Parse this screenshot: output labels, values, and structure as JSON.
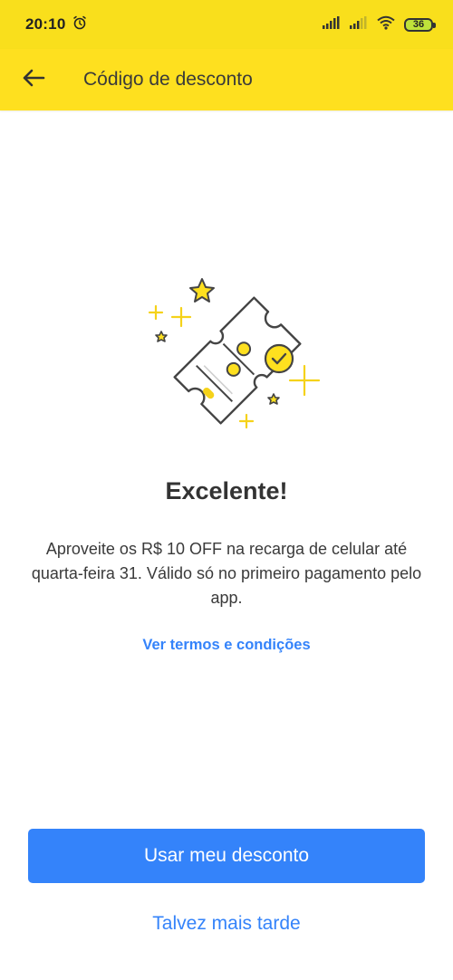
{
  "status_bar": {
    "time": "20:10",
    "battery": "36",
    "icons": [
      "alarm-icon",
      "signal-icon",
      "signal-icon",
      "wifi-icon",
      "battery-icon"
    ]
  },
  "app_bar": {
    "back_icon": "arrow-left-icon",
    "title": "Código de desconto"
  },
  "illustration": {
    "icon": "discount-ticket-icon",
    "colors": {
      "yellow": "#fee01f",
      "outline": "#444444"
    }
  },
  "content": {
    "heading": "Excelente!",
    "description": "Aproveite os R$ 10 OFF na recarga de celular até quarta-feira 31. Válido só no primeiro pagamento pelo app.",
    "terms_link": "Ver termos e condições"
  },
  "actions": {
    "primary_label": "Usar meu desconto",
    "secondary_label": "Talvez mais tarde"
  },
  "colors": {
    "brand_yellow": "#fee01f",
    "accent_blue": "#3483fa"
  }
}
